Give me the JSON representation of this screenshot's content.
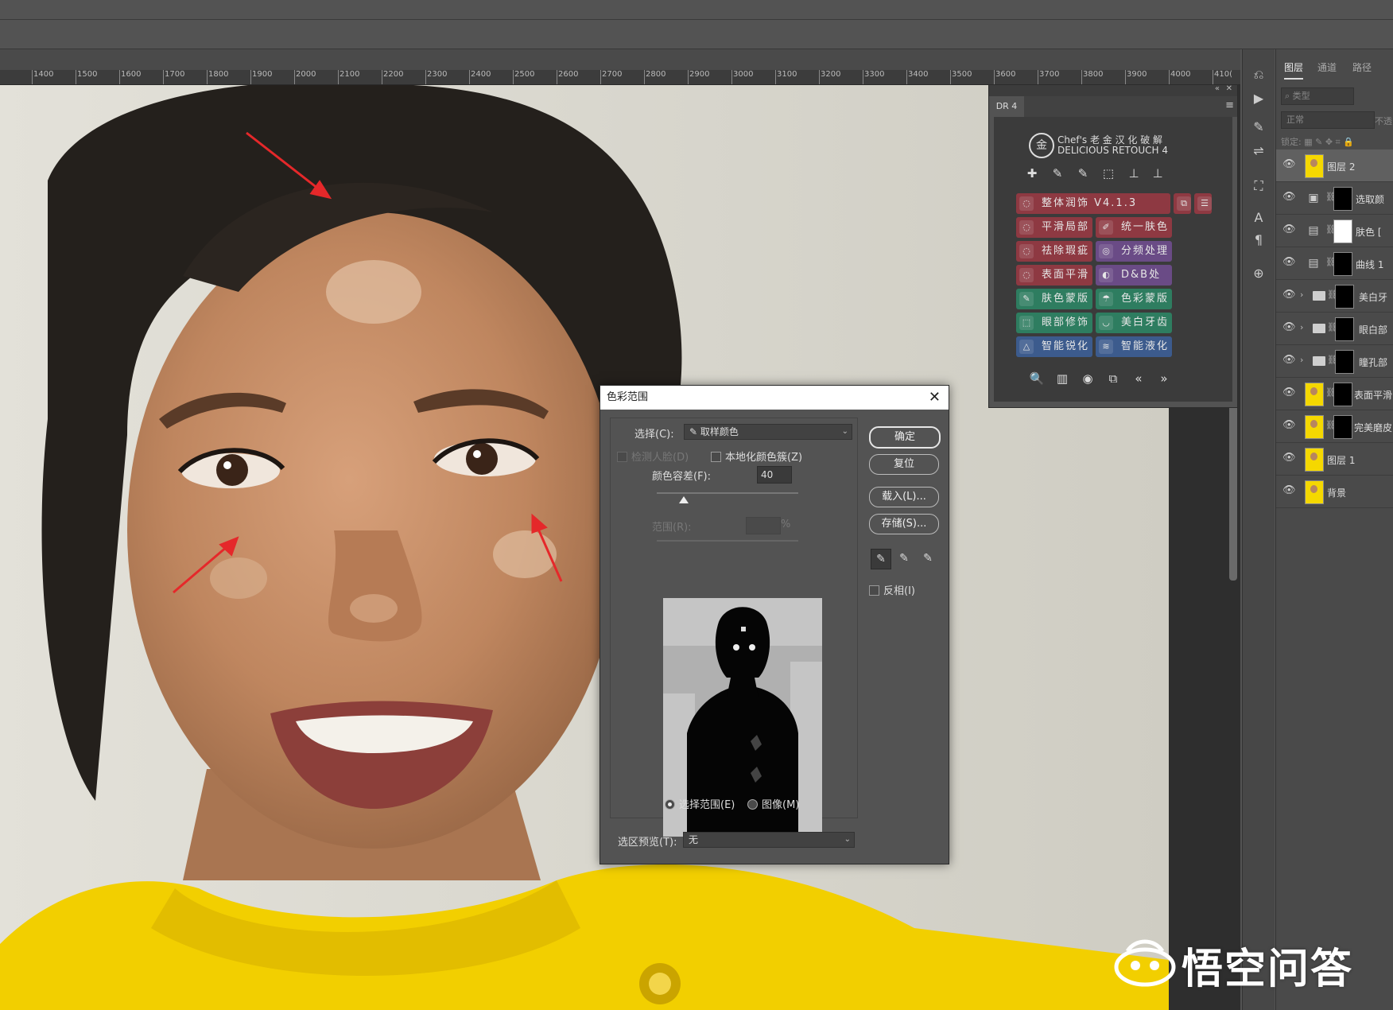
{
  "ruler": {
    "ticks": [
      "1400",
      "1500",
      "1600",
      "1700",
      "1800",
      "1900",
      "2000",
      "2100",
      "2200",
      "2300",
      "2400",
      "2500",
      "2600",
      "2700",
      "2800",
      "2900",
      "3000",
      "3100",
      "3200",
      "3300",
      "3400",
      "3500",
      "3600",
      "3700",
      "3800",
      "3900",
      "4000",
      "410("
    ]
  },
  "layers_panel": {
    "tabs": [
      "图层",
      "通道",
      "路径"
    ],
    "filter_placeholder": "类型",
    "blend_mode": "正常",
    "opacity_label": "不透",
    "lock_label": "锁定:",
    "layers": [
      {
        "name": "图层 2",
        "kind": "pixel",
        "selected": true
      },
      {
        "name": "选取颜",
        "kind": "adjustment-mask"
      },
      {
        "name": "肤色 [",
        "kind": "adjustment-white"
      },
      {
        "name": "曲线 1",
        "kind": "adjustment-mask"
      },
      {
        "name": "美白牙",
        "kind": "group"
      },
      {
        "name": "眼白部",
        "kind": "group"
      },
      {
        "name": "瞳孔部",
        "kind": "group"
      },
      {
        "name": "表面平滑",
        "kind": "pixel-mask"
      },
      {
        "name": "完美磨皮",
        "kind": "pixel-mask"
      },
      {
        "name": "图层 1",
        "kind": "pixel"
      },
      {
        "name": "背景",
        "kind": "pixel"
      }
    ]
  },
  "dr4": {
    "tab_label": "DR 4",
    "logo_char": "金",
    "brand_line1": "Chef's 老 金 汉 化 破 解",
    "brand_line2": "DELICIOUS RETOUCH 4",
    "buttons": [
      {
        "label": "整体润饰 V4.1.3",
        "color": "red"
      },
      {
        "label": "平滑局部",
        "color": "red"
      },
      {
        "label": "统一肤色",
        "color": "red"
      },
      {
        "label": "祛除瑕疵",
        "color": "red"
      },
      {
        "label": "分频处理",
        "color": "purple"
      },
      {
        "label": "表面平滑",
        "color": "red"
      },
      {
        "label": "D&B处理",
        "color": "purple"
      },
      {
        "label": "肤色蒙版",
        "color": "green"
      },
      {
        "label": "色彩蒙版",
        "color": "green"
      },
      {
        "label": "眼部修饰",
        "color": "green"
      },
      {
        "label": "美白牙齿",
        "color": "green"
      },
      {
        "label": "智能锐化",
        "color": "blue"
      },
      {
        "label": "智能液化",
        "color": "blue"
      }
    ],
    "bottom_icons": [
      "🔍",
      "▥",
      "◉",
      "⧉",
      "«",
      "»"
    ]
  },
  "dialog": {
    "title": "色彩范围",
    "select_label": "选择(C):",
    "select_value": "取样颜色",
    "detect_faces_label": "检测人脸(D)",
    "localized_label": "本地化颜色簇(Z)",
    "fuzziness_label": "颜色容差(F):",
    "fuzziness_value": "40",
    "range_label": "范围(R):",
    "range_unit": "%",
    "radio_selection": "选择范围(E)",
    "radio_image": "图像(M)",
    "preview_label": "选区预览(T):",
    "preview_value": "无",
    "ok": "确定",
    "reset": "复位",
    "load": "载入(L)...",
    "save": "存储(S)...",
    "invert_label": "反相(I)"
  },
  "watermark": {
    "text": "悟空问答"
  },
  "colors": {
    "accent_red": "#e5282a",
    "photo_yellow": "#f4d200"
  }
}
